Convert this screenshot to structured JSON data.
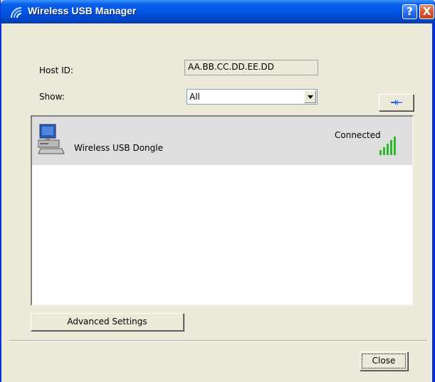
{
  "window": {
    "title": "Wireless USB Manager",
    "help_glyph": "?",
    "close_glyph": "X"
  },
  "form": {
    "host_id_label": "Host ID:",
    "host_id_value": "AA.BB.CC.DD.EE.DD",
    "show_label": "Show:",
    "show_value": "All",
    "refresh_icon": "refresh-icon"
  },
  "devices": [
    {
      "name": "Wireless USB Dongle",
      "status": "Connected",
      "icon": "computer-icon",
      "signal_bars": 5,
      "signal_max": 5
    }
  ],
  "buttons": {
    "advanced": "Advanced Settings",
    "close": "Close"
  },
  "colors": {
    "titlebar": "#0055e5",
    "face": "#ece9d8",
    "selected_row": "#dedede",
    "signal": "#2db82d"
  }
}
